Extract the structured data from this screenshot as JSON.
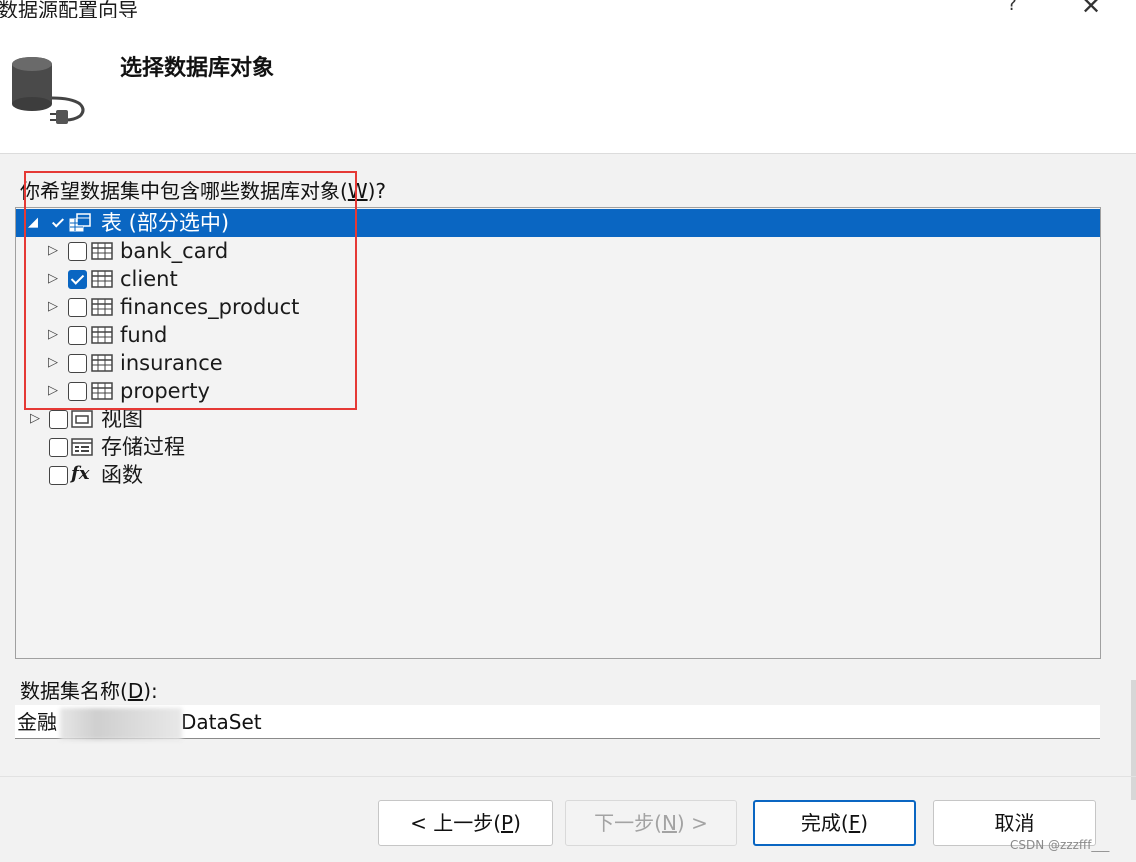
{
  "window": {
    "title": "数据源配置向导",
    "help_label": "?",
    "close_label": "✕"
  },
  "header": {
    "heading": "选择数据库对象",
    "icon": "database-plug-icon"
  },
  "question": {
    "text": "你希望数据集中包含哪些数据库对象(",
    "mnemonic": "W",
    "suffix": ")?"
  },
  "tree": {
    "root": {
      "label": "表 (部分选中)",
      "state": "partial",
      "expanded": true,
      "selected": true,
      "icon": "tables-icon"
    },
    "tables": [
      {
        "label": "bank_card",
        "checked": false,
        "icon": "table-icon"
      },
      {
        "label": "client",
        "checked": true,
        "icon": "table-icon"
      },
      {
        "label": "finances_product",
        "checked": false,
        "icon": "table-icon"
      },
      {
        "label": "fund",
        "checked": false,
        "icon": "table-icon"
      },
      {
        "label": "insurance",
        "checked": false,
        "icon": "table-icon"
      },
      {
        "label": "property",
        "checked": false,
        "icon": "table-icon"
      }
    ],
    "others": [
      {
        "label": "视图",
        "checked": false,
        "expandable": true,
        "icon": "view-icon"
      },
      {
        "label": "存储过程",
        "checked": false,
        "expandable": false,
        "icon": "stored-procedure-icon"
      },
      {
        "label": "函数",
        "checked": false,
        "expandable": false,
        "icon": "function-icon"
      }
    ]
  },
  "dataset": {
    "label_text": "数据集名称(",
    "label_mnemonic": "D",
    "label_suffix": "):",
    "value_prefix": "金融",
    "value_suffix": "DataSet"
  },
  "buttons": {
    "back": {
      "text": "< 上一步(",
      "mnemonic": "P",
      "suffix": ")"
    },
    "next": {
      "text": "下一步(",
      "mnemonic": "N",
      "suffix": ") >"
    },
    "finish": {
      "text": "完成(",
      "mnemonic": "F",
      "suffix": ")"
    },
    "cancel": {
      "text": "取消"
    }
  },
  "watermark": "CSDN @zzzfff___",
  "colors": {
    "selection": "#0a66c2",
    "highlight_box": "#e53935"
  }
}
